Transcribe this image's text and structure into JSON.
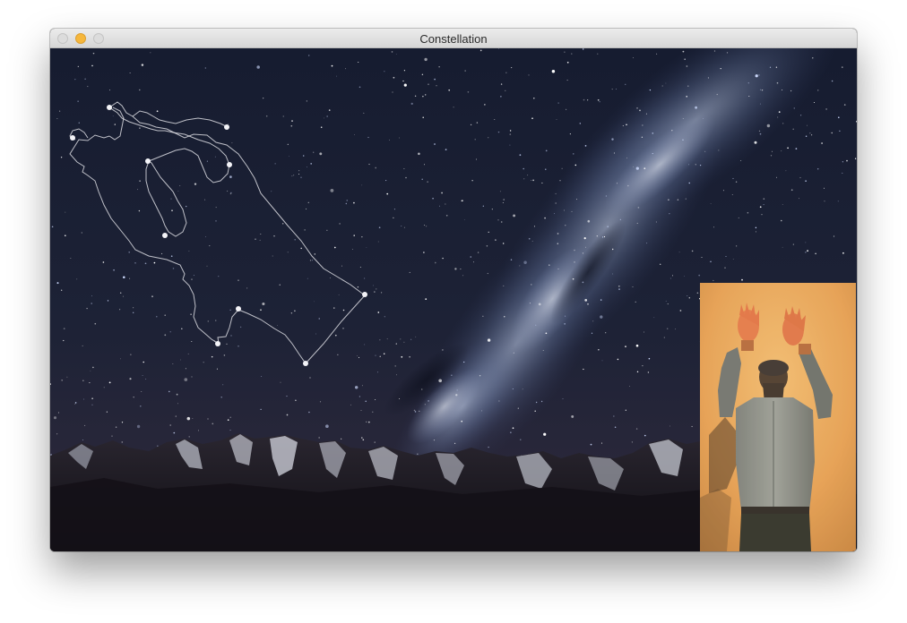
{
  "window": {
    "title": "Constellation",
    "controls": [
      "close",
      "minimize",
      "zoom"
    ]
  },
  "colors": {
    "sky_top": "#141a2e",
    "sky_bottom": "#2c2940",
    "milky_way": "#9fb2d6",
    "mountains": "#1a171d",
    "snow": "#c9cbd4",
    "constellation_line": "#e8e8ee",
    "webcam_background": "#e8a255"
  },
  "scene": {
    "background": "starry-night-sky-over-mountains",
    "overlay": "constellation-outline",
    "inset": "webcam-person-arms-raised"
  }
}
